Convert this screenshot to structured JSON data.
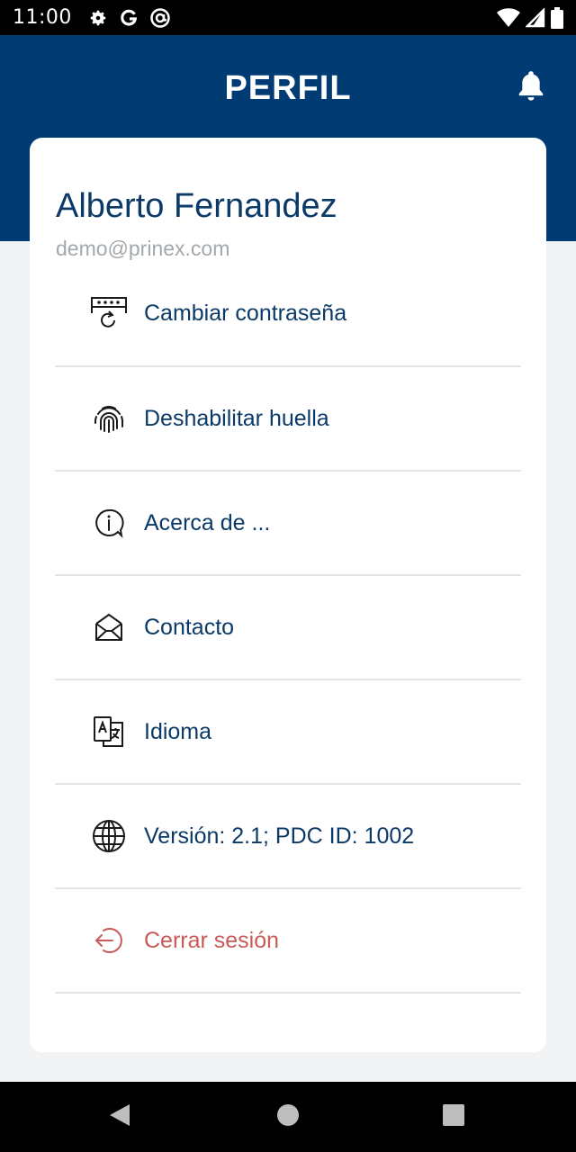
{
  "status_bar": {
    "time": "11:00",
    "left_icons": [
      "gear-icon",
      "google-g-icon",
      "at-sign-icon"
    ],
    "right_icons": [
      "wifi-icon",
      "signal-icon",
      "battery-icon"
    ]
  },
  "header": {
    "title": "PERFIL",
    "bell_icon": "bell-icon",
    "background_color": "#003b73"
  },
  "profile": {
    "name": "Alberto Fernandez",
    "email": "demo@prinex.com"
  },
  "menu": {
    "items": [
      {
        "icon": "password-change-icon",
        "label": "Cambiar contraseña"
      },
      {
        "icon": "fingerprint-icon",
        "label": "Deshabilitar huella"
      },
      {
        "icon": "info-icon",
        "label": "Acerca de ..."
      },
      {
        "icon": "envelope-icon",
        "label": "Contacto"
      },
      {
        "icon": "translate-icon",
        "label": "Idioma"
      },
      {
        "icon": "globe-icon",
        "label": "Versión: 2.1; PDC ID: 1002"
      },
      {
        "icon": "logout-icon",
        "label": "Cerrar sesión"
      }
    ]
  },
  "colors": {
    "primary": "#003b73",
    "text": "#0b3a68",
    "logout": "#c85a57",
    "email": "#a3a8ad"
  },
  "nav_bar": {
    "buttons": [
      "back-icon",
      "home-icon",
      "recents-icon"
    ]
  }
}
